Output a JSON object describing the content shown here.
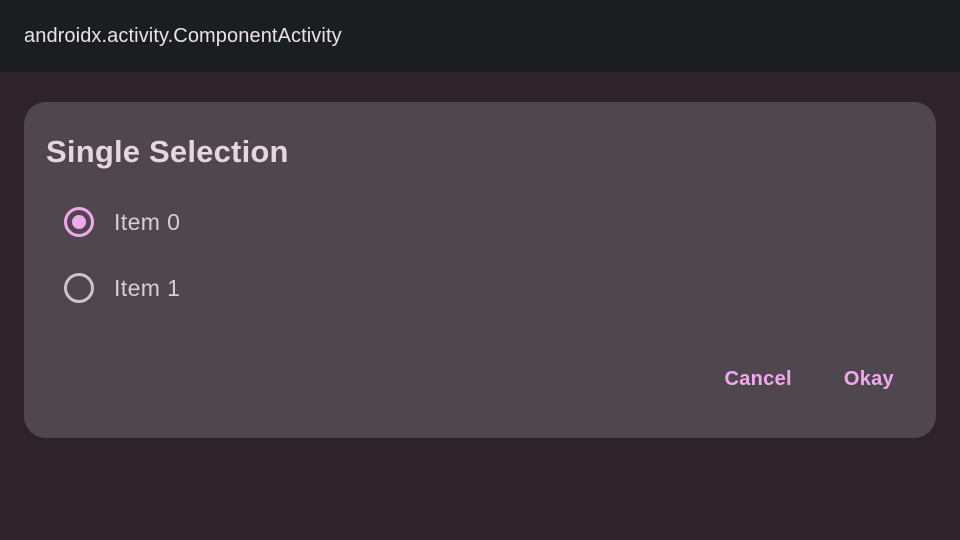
{
  "app_bar": {
    "title": "androidx.activity.ComponentActivity"
  },
  "dialog": {
    "title": "Single Selection",
    "options": [
      {
        "label": "Item 0",
        "selected": true
      },
      {
        "label": "Item 1",
        "selected": false
      }
    ],
    "actions": {
      "cancel_label": "Cancel",
      "confirm_label": "Okay"
    }
  },
  "colors": {
    "background": "#2e2328",
    "app_bar": "#1b1e20",
    "dialog_surface": "#4f474d",
    "accent": "#f2a8ef",
    "title_text": "#e7d6de",
    "body_text": "#d8cdd3",
    "radio_unchecked": "#cfc3ca"
  }
}
